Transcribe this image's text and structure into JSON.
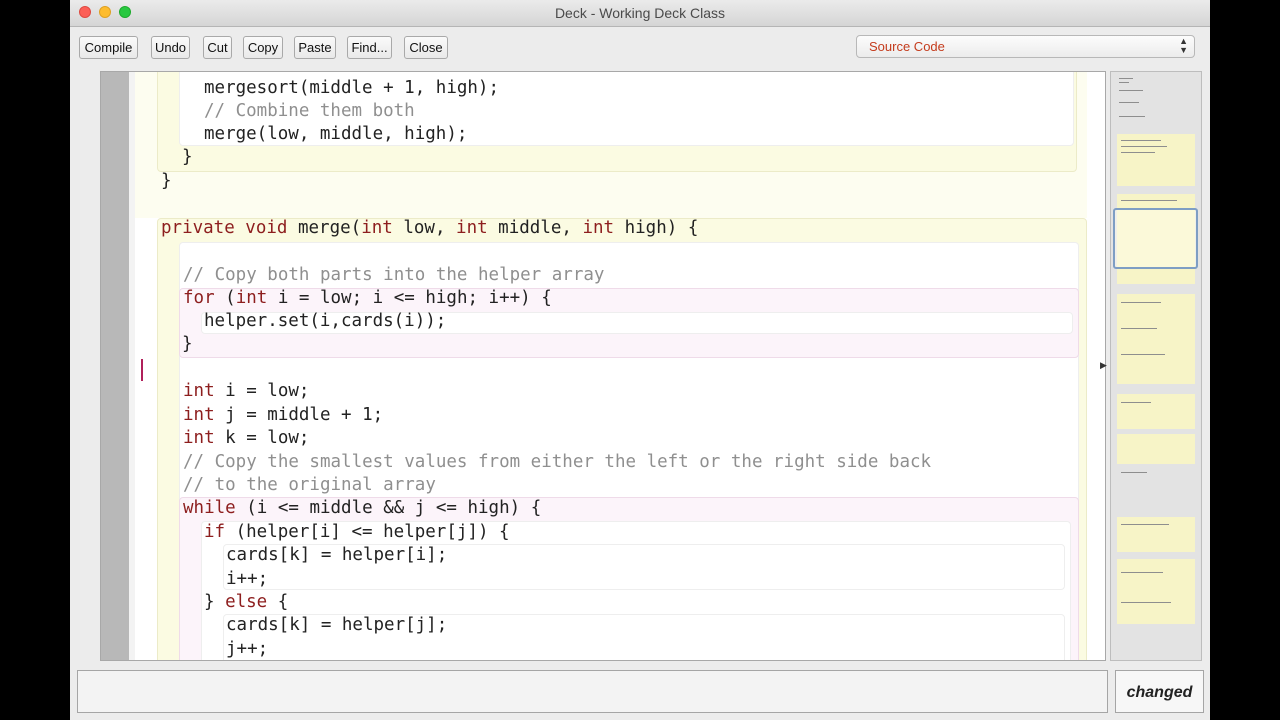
{
  "window": {
    "title": "Deck - Working Deck Class"
  },
  "toolbar": {
    "buttons": [
      "Compile",
      "Undo",
      "Cut",
      "Copy",
      "Paste",
      "Find...",
      "Close"
    ],
    "view_select": "Source Code"
  },
  "code": {
    "l01": "mergesort(middle + 1, high);",
    "l02": "// Combine them both",
    "l03": "merge(low, middle, high);",
    "l04": "}",
    "l05": "}",
    "l06_kw": "private void",
    "l06_a": " merge(",
    "l06_kw2": "int",
    "l06_b": " low, ",
    "l06_kw3": "int",
    "l06_c": " middle, ",
    "l06_kw4": "int",
    "l06_d": " high) {",
    "l07": "// Copy both parts into the helper array",
    "l08_kw": "for",
    "l08_a": " (",
    "l08_kw2": "int",
    "l08_b": " i = low; i <= high; i++) {",
    "l09": "helper.set(i,cards(i));",
    "l10": "}",
    "l11_kw": "int",
    "l11": " i = low;",
    "l12_kw": "int",
    "l12": " j = middle + 1;",
    "l13_kw": "int",
    "l13": " k = low;",
    "l14": "// Copy the smallest values from either the left or the right side back",
    "l15": "// to the original array",
    "l16_kw": "while",
    "l16": " (i <= middle && j <= high) {",
    "l17_kw": "if",
    "l17": " (helper[i] <= helper[j]) {",
    "l18": "cards[k] = helper[i];",
    "l19": "i++;",
    "l20_a": "} ",
    "l20_kw": "else",
    "l20_b": " {",
    "l21": "cards[k] = helper[j];",
    "l22": "j++;"
  },
  "status": {
    "message": "",
    "changed": "changed"
  },
  "colors": {
    "keyword": "#8d1e1e",
    "comment": "#8f8f8f",
    "method_scope": "#fbfbe2",
    "loop_scope": "#fcf4fa"
  }
}
